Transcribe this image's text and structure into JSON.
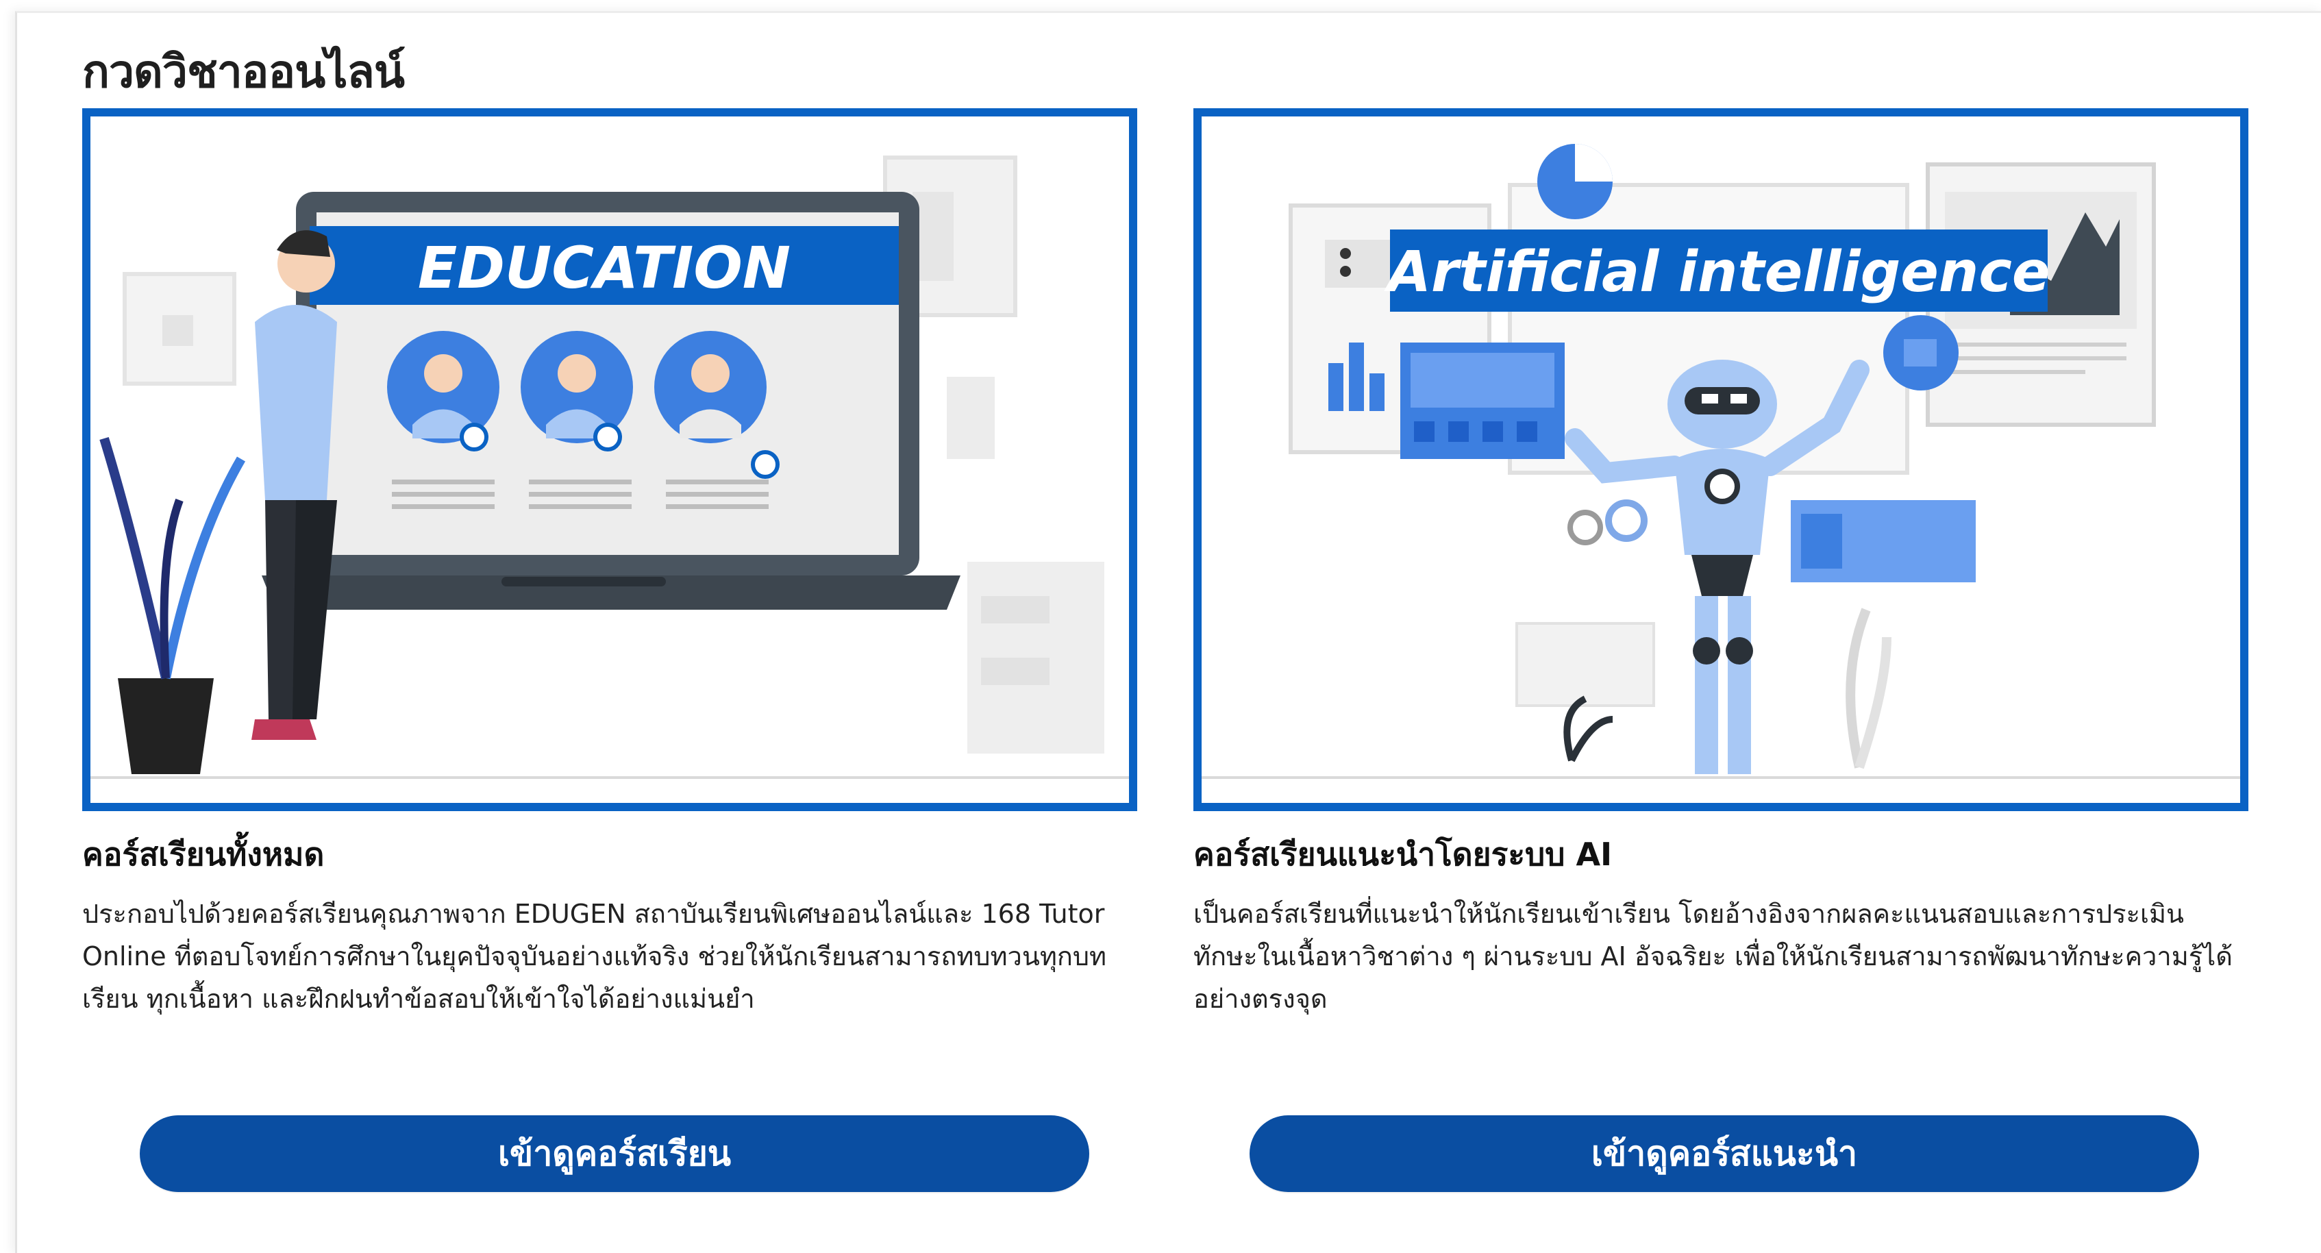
{
  "section": {
    "title": "กวดวิชาออนไลน์"
  },
  "cards": [
    {
      "banner": "EDUCATION",
      "title": "คอร์สเรียนทั้งหมด",
      "description": "ประกอบไปด้วยคอร์สเรียนคุณภาพจาก EDUGEN สถาบันเรียนพิเศษออนไลน์และ 168 Tutor Online ที่ตอบโจทย์การศึกษาในยุคปัจจุบันอย่างแท้จริง ช่วยให้นักเรียนสามารถทบทวนทุกบทเรียน ทุกเนื้อหา และฝึกฝนทำข้อสอบให้เข้าใจได้อย่างแม่นยำ",
      "button": "เข้าดูคอร์สเรียน"
    },
    {
      "banner": "Artificial intelligence",
      "title": "คอร์สเรียนแนะนำโดยระบบ AI",
      "description": "เป็นคอร์สเรียนที่แนะนำให้นักเรียนเข้าเรียน โดยอ้างอิงจากผลคะแนนสอบและการประเมินทักษะในเนื้อหาวิชาต่าง ๆ ผ่านระบบ AI อัจฉริยะ เพื่อให้นักเรียนสามารถพัฒนาทักษะความรู้ได้อย่างตรงจุด",
      "button": "เข้าดูคอร์สแนะนำ"
    }
  ],
  "colors": {
    "accent": "#0a62c4",
    "button": "#0a4ea2",
    "illustration_blue": "#3d7fe0"
  }
}
